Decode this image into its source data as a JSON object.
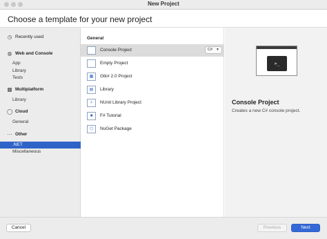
{
  "window": {
    "title": "New Project"
  },
  "header": {
    "title": "Choose a template for your new project"
  },
  "sidebar": {
    "recent": {
      "label": "Recently used",
      "icon": "clock-icon"
    },
    "groups": [
      {
        "label": "Web and Console",
        "icon": "globe-icon",
        "items": [
          "App",
          "Library",
          "Tests"
        ]
      },
      {
        "label": "Multiplatform",
        "icon": "devices-icon",
        "items": [
          "Library"
        ]
      },
      {
        "label": "Cloud",
        "icon": "cloud-icon",
        "items": [
          "General"
        ]
      },
      {
        "label": "Other",
        "icon": "ellipsis-icon",
        "items": [
          ".NET",
          "Miscellaneous"
        ]
      }
    ],
    "selected": ".NET"
  },
  "templates": {
    "section": "General",
    "items": [
      {
        "label": "Console Project",
        "icon": "console-icon",
        "language": "C#"
      },
      {
        "label": "Empty Project",
        "icon": "empty-project-icon"
      },
      {
        "label": "Gtk# 2.0 Project",
        "icon": "gtk-icon"
      },
      {
        "label": "Library",
        "icon": "library-icon"
      },
      {
        "label": "NUnit Library Project",
        "icon": "nunit-icon"
      },
      {
        "label": "F# Tutorial",
        "icon": "fsharp-icon"
      },
      {
        "label": "NuGet Package",
        "icon": "nuget-icon"
      }
    ],
    "selected": "Console Project"
  },
  "detail": {
    "title": "Console Project",
    "description": "Creates a new C# console project.",
    "prompt_glyph": ">_"
  },
  "footer": {
    "cancel": "Cancel",
    "previous": "Previous",
    "next": "Next"
  },
  "colors": {
    "accent": "#3369d6",
    "selection": "#2f63c7"
  }
}
